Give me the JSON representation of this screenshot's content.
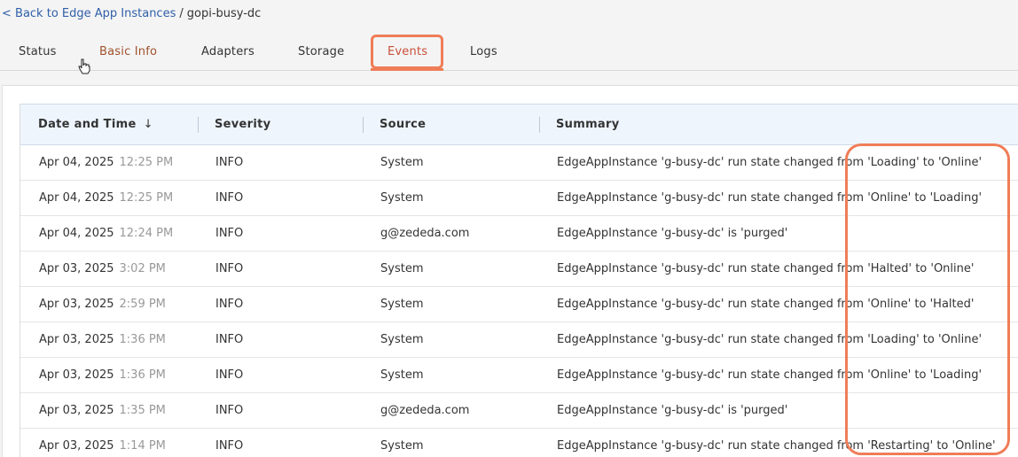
{
  "breadcrumb": {
    "back_label": "< Back to Edge App Instances",
    "separator": "/",
    "current": "gopi-busy-dc"
  },
  "tabs": [
    {
      "label": "Status"
    },
    {
      "label": "Basic Info"
    },
    {
      "label": "Adapters"
    },
    {
      "label": "Storage"
    },
    {
      "label": "Events"
    },
    {
      "label": "Logs"
    }
  ],
  "active_tab": "Events",
  "table": {
    "columns": [
      {
        "label": "Date and Time",
        "sort_indicator": "↓"
      },
      {
        "label": "Severity"
      },
      {
        "label": "Source"
      },
      {
        "label": "Summary"
      }
    ],
    "rows": [
      {
        "date": "Apr 04, 2025",
        "time": "12:25 PM",
        "severity": "INFO",
        "source": "System",
        "summary": "EdgeAppInstance 'g-busy-dc' run state changed from 'Loading' to 'Online'"
      },
      {
        "date": "Apr 04, 2025",
        "time": "12:25 PM",
        "severity": "INFO",
        "source": "System",
        "summary": "EdgeAppInstance 'g-busy-dc' run state changed from 'Online' to 'Loading'"
      },
      {
        "date": "Apr 04, 2025",
        "time": "12:24 PM",
        "severity": "INFO",
        "source": "g@zededa.com",
        "summary": "EdgeAppInstance 'g-busy-dc' is 'purged'"
      },
      {
        "date": "Apr 03, 2025",
        "time": "3:02 PM",
        "severity": "INFO",
        "source": "System",
        "summary": "EdgeAppInstance 'g-busy-dc' run state changed from 'Halted' to 'Online'"
      },
      {
        "date": "Apr 03, 2025",
        "time": "2:59 PM",
        "severity": "INFO",
        "source": "System",
        "summary": "EdgeAppInstance 'g-busy-dc' run state changed from 'Online' to 'Halted'"
      },
      {
        "date": "Apr 03, 2025",
        "time": "1:36 PM",
        "severity": "INFO",
        "source": "System",
        "summary": "EdgeAppInstance 'g-busy-dc' run state changed from 'Loading' to 'Online'"
      },
      {
        "date": "Apr 03, 2025",
        "time": "1:36 PM",
        "severity": "INFO",
        "source": "System",
        "summary": "EdgeAppInstance 'g-busy-dc' run state changed from 'Online' to 'Loading'"
      },
      {
        "date": "Apr 03, 2025",
        "time": "1:35 PM",
        "severity": "INFO",
        "source": "g@zededa.com",
        "summary": "EdgeAppInstance 'g-busy-dc' is 'purged'"
      },
      {
        "date": "Apr 03, 2025",
        "time": "1:14 PM",
        "severity": "INFO",
        "source": "System",
        "summary": "EdgeAppInstance 'g-busy-dc' run state changed from 'Restarting' to 'Online'"
      }
    ]
  },
  "colors": {
    "accent": "#ef7d57",
    "header_bg": "#eef5fd",
    "link": "#2f5fa8"
  },
  "icons": {
    "cursor": "hand-cursor-icon"
  }
}
